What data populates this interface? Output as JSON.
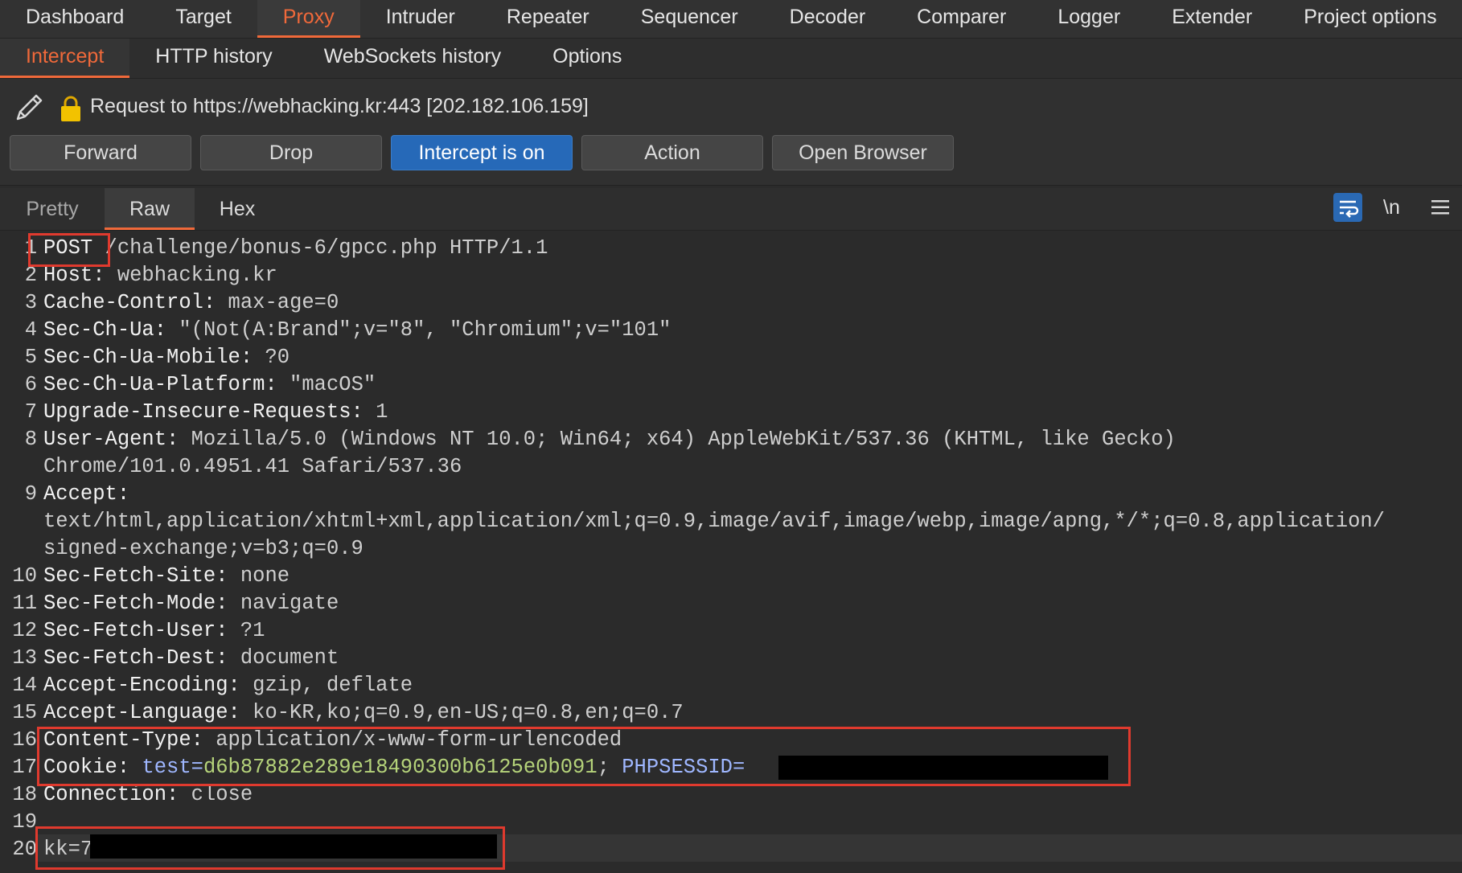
{
  "main_tabs": [
    "Dashboard",
    "Target",
    "Proxy",
    "Intruder",
    "Repeater",
    "Sequencer",
    "Decoder",
    "Comparer",
    "Logger",
    "Extender",
    "Project options"
  ],
  "sub_tabs": [
    "Intercept",
    "HTTP history",
    "WebSockets history",
    "Options"
  ],
  "request_info": "Request to https://webhacking.kr:443  [202.182.106.159]",
  "buttons": {
    "forward": "Forward",
    "drop": "Drop",
    "intercept": "Intercept is on",
    "action": "Action",
    "open_browser": "Open Browser"
  },
  "editor_tabs": {
    "pretty": "Pretty",
    "raw": "Raw",
    "hex": "Hex"
  },
  "newline_toggle": "\\n",
  "line_numbers": [
    "1",
    "2",
    "3",
    "4",
    "5",
    "6",
    "7",
    "8",
    "9",
    "10",
    "11",
    "12",
    "13",
    "14",
    "15",
    "16",
    "17",
    "18",
    "19",
    "20"
  ],
  "request": {
    "method": "POST",
    "request_line_rest": " /challenge/bonus-6/gpcc.php HTTP/1.1",
    "host_k": "Host:",
    "host_v": " webhacking.kr",
    "cache_k": "Cache-Control:",
    "cache_v": " max-age=0",
    "secua_k": "Sec-Ch-Ua:",
    "secua_v": " \"(Not(A:Brand\";v=\"8\", \"Chromium\";v=\"101\"",
    "mobile_k": "Sec-Ch-Ua-Mobile:",
    "mobile_v": " ?0",
    "platform_k": "Sec-Ch-Ua-Platform:",
    "platform_v": " \"macOS\"",
    "upgrade_k": "Upgrade-Insecure-Requests:",
    "upgrade_v": " 1",
    "ua_k": "User-Agent:",
    "ua_v": " Mozilla/5.0 (Windows NT 10.0; Win64; x64) AppleWebKit/537.36 (KHTML, like Gecko)",
    "ua_v2": "Chrome/101.0.4951.41 Safari/537.36",
    "accept_k": "Accept:",
    "accept_v1": "text/html,application/xhtml+xml,application/xml;q=0.9,image/avif,image/webp,image/apng,*/*;q=0.8,application/",
    "accept_v2": "signed-exchange;v=b3;q=0.9",
    "site_k": "Sec-Fetch-Site:",
    "site_v": " none",
    "mode_k": "Sec-Fetch-Mode:",
    "mode_v": " navigate",
    "user_k": "Sec-Fetch-User:",
    "user_v": " ?1",
    "dest_k": "Sec-Fetch-Dest:",
    "dest_v": " document",
    "enc_k": "Accept-Encoding:",
    "enc_v": " gzip, deflate",
    "lang_k": "Accept-Language:",
    "lang_v": " ko-KR,ko;q=0.9,en-US;q=0.8,en;q=0.7",
    "ctype_k": "Content-Type:",
    "ctype_v": " application/x-www-form-urlencoded",
    "cookie_k": "Cookie:",
    "cookie_name1": " test=",
    "cookie_val1": "d6b87882e289e18490300b6125e0b091",
    "cookie_sep": ";",
    "cookie_name2": " PHPSESSID=",
    "conn_k": "Connection:",
    "conn_v": " close",
    "body": "kk=7"
  },
  "colors": {
    "accent": "#f0693a",
    "primary_button": "#2669b8",
    "annotation_red": "#e03a2e"
  },
  "icons": [
    "pencil-icon",
    "lock-icon",
    "word-wrap-icon",
    "hamburger-menu-icon"
  ]
}
